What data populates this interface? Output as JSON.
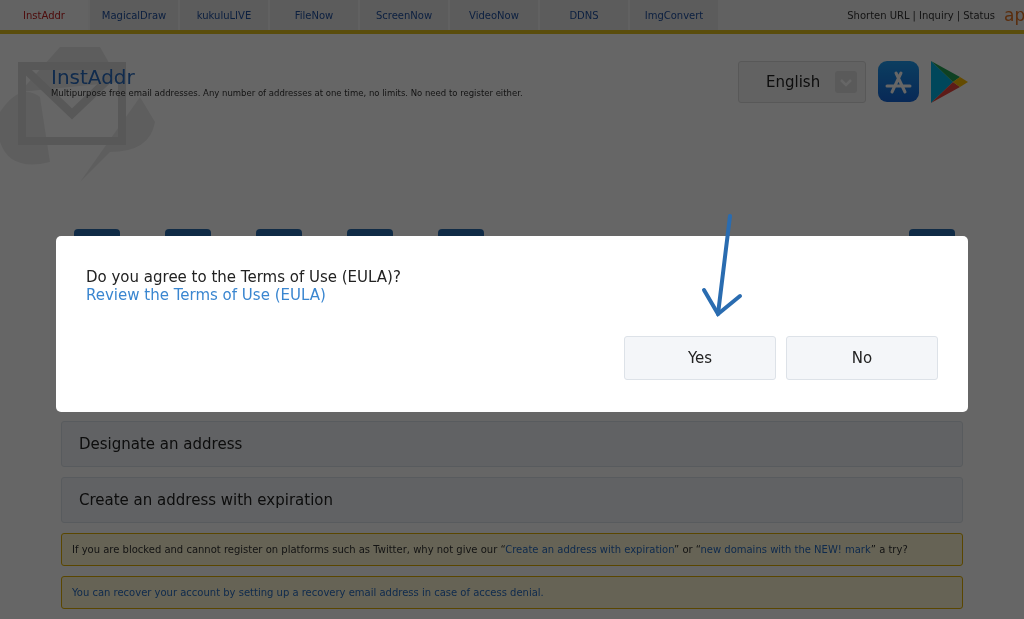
{
  "nav": {
    "items": [
      {
        "label": "InstAddr",
        "selected": true
      },
      {
        "label": "MagicalDraw",
        "selected": false
      },
      {
        "label": "kukuluLIVE",
        "selected": false
      },
      {
        "label": "FileNow",
        "selected": false
      },
      {
        "label": "ScreenNow",
        "selected": false
      },
      {
        "label": "VideoNow",
        "selected": false
      },
      {
        "label": "DDNS",
        "selected": false
      },
      {
        "label": "ImgConvert",
        "selected": false
      }
    ],
    "links": [
      "Shorten URL",
      "Inquiry",
      "Status"
    ],
    "separator": "|",
    "brand": "ap"
  },
  "header": {
    "title": "InstAddr",
    "subtitle": "Multipurpose free email addresses. Any number of addresses at one time, no limits. No need to register either.",
    "language": "English"
  },
  "sections": [
    "Designate an address",
    "Create an address with expiration"
  ],
  "notices": [
    {
      "parts": [
        {
          "kind": "text",
          "text": "If you are blocked and cannot register on platforms such as Twitter, why not give our “"
        },
        {
          "kind": "link",
          "text": "Create an address with expiration"
        },
        {
          "kind": "text",
          "text": "” or “"
        },
        {
          "kind": "link",
          "text": "new domains with the NEW! mark"
        },
        {
          "kind": "text",
          "text": "” a try?"
        }
      ]
    },
    {
      "parts": [
        {
          "kind": "link",
          "text": "You can recover your account by setting up a recovery email address in case of access denial."
        }
      ]
    }
  ],
  "dialog": {
    "question": "Do you agree to the Terms of Use (EULA)?",
    "link": "Review the Terms of Use (EULA)",
    "buttons": [
      "Yes",
      "No"
    ]
  }
}
